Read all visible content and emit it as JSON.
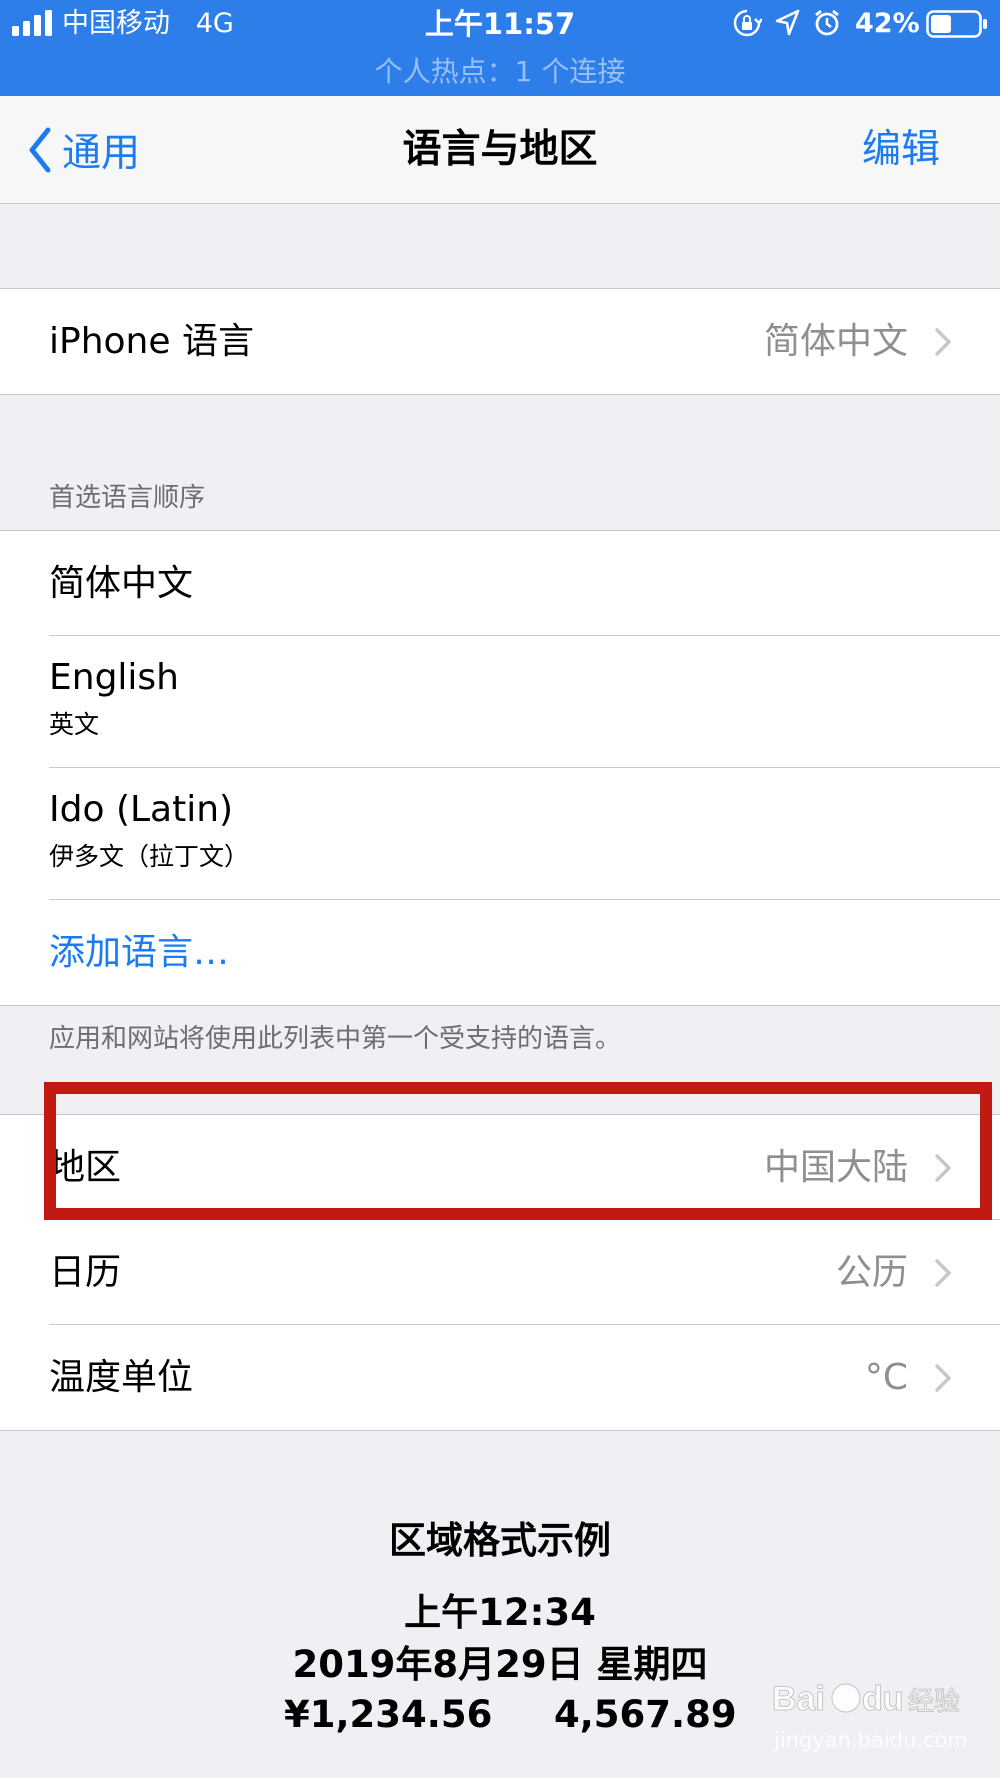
{
  "status_bar": {
    "carrier": "中国移动",
    "network": "4G",
    "time": "上午11:57",
    "battery": "42%",
    "hotspot": "个人热点：1 个连接"
  },
  "nav": {
    "back_label": "通用",
    "title": "语言与地区",
    "edit_label": "编辑"
  },
  "iphone_language": {
    "label": "iPhone 语言",
    "value": "简体中文"
  },
  "preferred_languages": {
    "header": "首选语言顺序",
    "items": [
      {
        "name": "简体中文",
        "sub": ""
      },
      {
        "name": "English",
        "sub": "英文"
      },
      {
        "name": "Ido (Latin)",
        "sub": "伊多文（拉丁文）"
      }
    ],
    "add_label": "添加语言…",
    "footer": "应用和网站将使用此列表中第一个受支持的语言。"
  },
  "region_settings": [
    {
      "label": "地区",
      "value": "中国大陆"
    },
    {
      "label": "日历",
      "value": "公历"
    },
    {
      "label": "温度单位",
      "value": "°C"
    }
  ],
  "format_example": {
    "title": "区域格式示例",
    "time": "上午12:34",
    "date": "2019年8月29日 星期四",
    "currency": "¥1,234.56",
    "number": "4,567.89"
  },
  "watermark": {
    "logo": "Baidu经验",
    "url": "jingyan.baidu.com"
  },
  "colors": {
    "status_bar": "#2d7ee8",
    "accent": "#1a7cf0",
    "highlight": "#c01a12",
    "secondary_text": "#8e8e93"
  }
}
